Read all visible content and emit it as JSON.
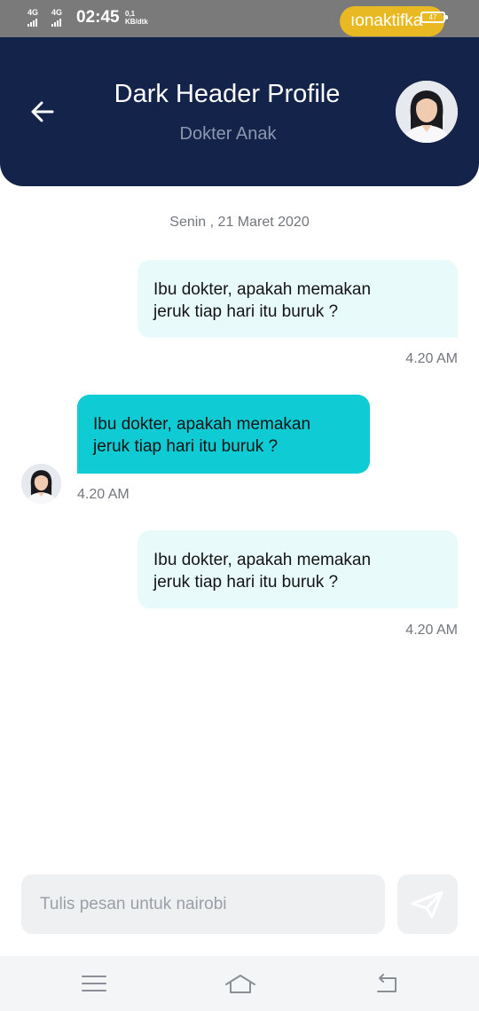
{
  "status_bar": {
    "network_1": "4G",
    "network_2": "4G",
    "clock": "02:45",
    "speed_value": "0,1",
    "speed_unit": "KB/dtk",
    "notification_pill": "ıonaktifka",
    "battery": "47"
  },
  "header": {
    "title": "Dark Header Profile",
    "subtitle": "Dokter Anak",
    "background_color": "#13234a",
    "avatar_icon": "doctor-avatar"
  },
  "chat": {
    "date_label": "Senin , 21 Maret 2020",
    "messages": [
      {
        "direction": "outgoing",
        "line1": "Ibu dokter, apakah memakan",
        "line2": "jeruk tiap hari itu buruk ?",
        "time": "4.20 AM",
        "color": "#e9fafb"
      },
      {
        "direction": "incoming",
        "line1": "Ibu dokter, apakah memakan",
        "line2": "jeruk tiap hari itu buruk ?",
        "time": "4.20 AM",
        "color": "#0fcbd4"
      },
      {
        "direction": "outgoing",
        "line1": "Ibu dokter, apakah memakan",
        "line2": "jeruk tiap hari itu buruk ?",
        "time": "4.20 AM",
        "color": "#e9fafb"
      }
    ]
  },
  "composer": {
    "placeholder": "Tulis pesan untuk nairobi",
    "value": "",
    "send_icon": "send-icon"
  },
  "nav_bar": {
    "icons": [
      "menu-icon",
      "home-icon",
      "back-nav-icon"
    ]
  }
}
